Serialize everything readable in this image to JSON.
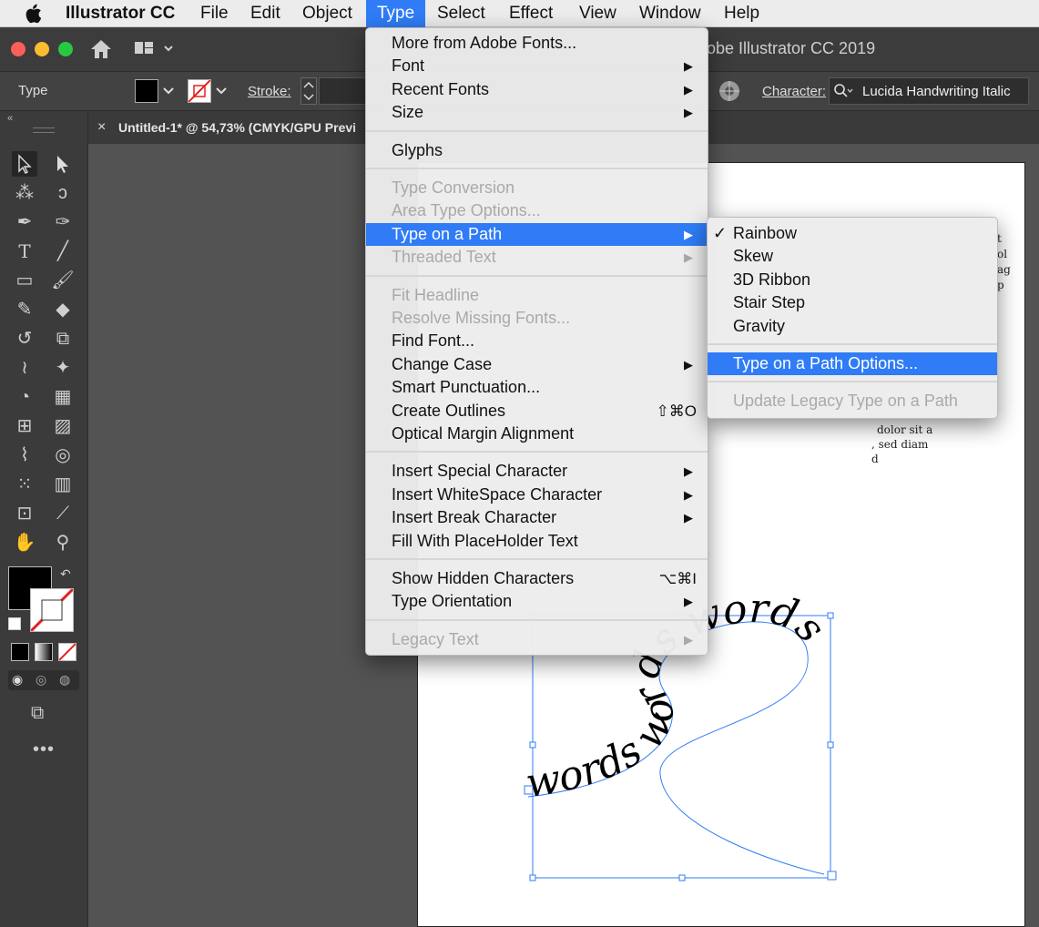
{
  "menubar": {
    "apple": "",
    "app_name": "Illustrator CC",
    "items": [
      "File",
      "Edit",
      "Object",
      "Type",
      "Select",
      "Effect",
      "View",
      "Window",
      "Help"
    ]
  },
  "window": {
    "title_fragment": "obe Illustrator CC 2019"
  },
  "control_bar": {
    "selection_label": "Type",
    "stroke_label": "Stroke:",
    "character_label": "Character:",
    "font_value": "Lucida Handwriting Italic"
  },
  "tab": {
    "close": "×",
    "title": "Untitled-1* @ 54,73% (CMYK/GPU Previ"
  },
  "type_menu": {
    "groups": [
      [
        {
          "label": "More from Adobe Fonts...",
          "enabled": true
        },
        {
          "label": "Font",
          "enabled": true,
          "submenu": true
        },
        {
          "label": "Recent Fonts",
          "enabled": true,
          "submenu": true
        },
        {
          "label": "Size",
          "enabled": true,
          "submenu": true
        }
      ],
      [
        {
          "label": "Glyphs",
          "enabled": true
        }
      ],
      [
        {
          "label": "Type Conversion",
          "enabled": false
        },
        {
          "label": "Area Type Options...",
          "enabled": false
        },
        {
          "label": "Type on a Path",
          "enabled": true,
          "submenu": true,
          "highlighted": true
        },
        {
          "label": "Threaded Text",
          "enabled": false,
          "submenu": true
        }
      ],
      [
        {
          "label": "Fit Headline",
          "enabled": false
        },
        {
          "label": "Resolve Missing Fonts...",
          "enabled": false
        },
        {
          "label": "Find Font...",
          "enabled": true
        },
        {
          "label": "Change Case",
          "enabled": true,
          "submenu": true
        },
        {
          "label": "Smart Punctuation...",
          "enabled": true
        },
        {
          "label": "Create Outlines",
          "enabled": true,
          "shortcut": "⇧⌘O"
        },
        {
          "label": "Optical Margin Alignment",
          "enabled": true
        }
      ],
      [
        {
          "label": "Insert Special Character",
          "enabled": true,
          "submenu": true
        },
        {
          "label": "Insert WhiteSpace Character",
          "enabled": true,
          "submenu": true
        },
        {
          "label": "Insert Break Character",
          "enabled": true,
          "submenu": true
        },
        {
          "label": "Fill With PlaceHolder Text",
          "enabled": true
        }
      ],
      [
        {
          "label": "Show Hidden Characters",
          "enabled": true,
          "shortcut": "⌥⌘I"
        },
        {
          "label": "Type Orientation",
          "enabled": true,
          "submenu": true
        }
      ],
      [
        {
          "label": "Legacy Text",
          "enabled": false,
          "submenu": true
        }
      ]
    ]
  },
  "submenu": {
    "groups": [
      [
        {
          "label": "Rainbow",
          "checked": true,
          "enabled": true
        },
        {
          "label": "Skew",
          "enabled": true
        },
        {
          "label": "3D Ribbon",
          "enabled": true
        },
        {
          "label": "Stair Step",
          "enabled": true
        },
        {
          "label": "Gravity",
          "enabled": true
        }
      ],
      [
        {
          "label": "Type on a Path Options...",
          "enabled": true,
          "highlighted": true
        }
      ],
      [
        {
          "label": "Update Legacy Type on a Path",
          "enabled": false
        }
      ]
    ]
  },
  "artwork": {
    "path_text": "words words words",
    "sample_lines": [
      "t",
      "ol",
      "ag",
      "p",
      "dolor sit a",
      ", sed diam",
      "d"
    ]
  },
  "colors": {
    "accent": "#2f7cf6",
    "selection": "#2f7cf6"
  }
}
